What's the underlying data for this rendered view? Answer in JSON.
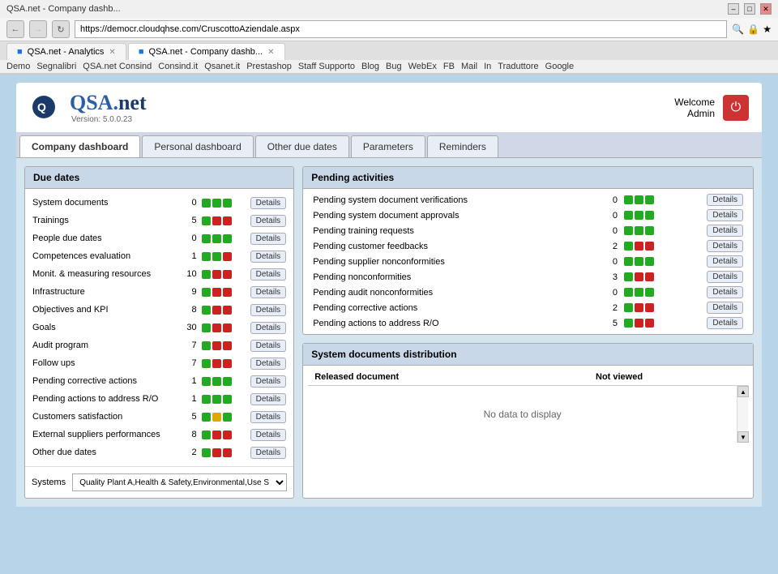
{
  "browser": {
    "title": "QSA.net - Company dashb...",
    "address": "https://democr.cloudqhse.com/CruscottoAziendale.aspx",
    "tabs": [
      {
        "label": "QSA.net - Analytics",
        "active": false,
        "icon": "🟦"
      },
      {
        "label": "QSA.net - Company dashb...",
        "active": true,
        "icon": "🟦"
      }
    ],
    "bookmarks": [
      {
        "label": "Demo"
      },
      {
        "label": "Segnalibri"
      },
      {
        "label": "QSA.net Consind"
      },
      {
        "label": "Consind.it"
      },
      {
        "label": "Qsanet.it"
      },
      {
        "label": "Prestashop"
      },
      {
        "label": "Staff Supporto"
      },
      {
        "label": "Blog"
      },
      {
        "label": "Bug"
      },
      {
        "label": "WebEx"
      },
      {
        "label": "FB"
      },
      {
        "label": "Mail"
      },
      {
        "label": "In"
      },
      {
        "label": "Traduttore"
      },
      {
        "label": "Google"
      }
    ]
  },
  "app": {
    "logo_text": "QSA.net",
    "version": "Version: 5.0.0.23",
    "welcome_label": "Welcome",
    "user_name": "Admin"
  },
  "nav_tabs": {
    "tabs": [
      {
        "label": "Company dashboard",
        "active": true
      },
      {
        "label": "Personal dashboard",
        "active": false
      },
      {
        "label": "Other due dates",
        "active": false
      },
      {
        "label": "Parameters",
        "active": false
      },
      {
        "label": "Reminders",
        "active": false
      }
    ]
  },
  "due_dates": {
    "title": "Due dates",
    "rows": [
      {
        "label": "System documents",
        "count": "0",
        "lights": [
          "green",
          "green",
          "green"
        ],
        "btn": "Details"
      },
      {
        "label": "Trainings",
        "count": "5",
        "lights": [
          "green",
          "red",
          "red"
        ],
        "btn": "Details"
      },
      {
        "label": "People due dates",
        "count": "0",
        "lights": [
          "green",
          "green",
          "green"
        ],
        "btn": "Details"
      },
      {
        "label": "Competences evaluation",
        "count": "1",
        "lights": [
          "green",
          "green",
          "red"
        ],
        "btn": "Details"
      },
      {
        "label": "Monit. & measuring resources",
        "count": "10",
        "lights": [
          "green",
          "red",
          "red"
        ],
        "btn": "Details"
      },
      {
        "label": "Infrastructure",
        "count": "9",
        "lights": [
          "green",
          "red",
          "red"
        ],
        "btn": "Details"
      },
      {
        "label": "Objectives and KPI",
        "count": "8",
        "lights": [
          "green",
          "red",
          "red"
        ],
        "btn": "Details"
      },
      {
        "label": "Goals",
        "count": "30",
        "lights": [
          "green",
          "red",
          "red"
        ],
        "btn": "Details"
      },
      {
        "label": "Audit program",
        "count": "7",
        "lights": [
          "green",
          "red",
          "red"
        ],
        "btn": "Details"
      },
      {
        "label": "Follow ups",
        "count": "7",
        "lights": [
          "green",
          "red",
          "red"
        ],
        "btn": "Details"
      },
      {
        "label": "Pending corrective actions",
        "count": "1",
        "lights": [
          "green",
          "green",
          "green"
        ],
        "btn": "Details"
      },
      {
        "label": "Pending actions to address R/O",
        "count": "1",
        "lights": [
          "green",
          "green",
          "green"
        ],
        "btn": "Details"
      },
      {
        "label": "Customers satisfaction",
        "count": "5",
        "lights": [
          "green",
          "yellow",
          "green"
        ],
        "btn": "Details"
      },
      {
        "label": "External suppliers performances",
        "count": "8",
        "lights": [
          "green",
          "red",
          "red"
        ],
        "btn": "Details"
      },
      {
        "label": "Other due dates",
        "count": "2",
        "lights": [
          "green",
          "red",
          "red"
        ],
        "btn": "Details"
      }
    ],
    "systems_label": "Systems",
    "systems_value": "Quality Plant A,Health & Safety,Environmental,Use S"
  },
  "pending_activities": {
    "title": "Pending activities",
    "rows": [
      {
        "label": "Pending system document verifications",
        "count": "0",
        "lights": [
          "green",
          "green",
          "green"
        ],
        "btn": "Details"
      },
      {
        "label": "Pending system document approvals",
        "count": "0",
        "lights": [
          "green",
          "green",
          "green"
        ],
        "btn": "Details"
      },
      {
        "label": "Pending training requests",
        "count": "0",
        "lights": [
          "green",
          "green",
          "green"
        ],
        "btn": "Details"
      },
      {
        "label": "Pending customer feedbacks",
        "count": "2",
        "lights": [
          "green",
          "red",
          "red"
        ],
        "btn": "Details"
      },
      {
        "label": "Pending supplier nonconformities",
        "count": "0",
        "lights": [
          "green",
          "green",
          "green"
        ],
        "btn": "Details"
      },
      {
        "label": "Pending nonconformities",
        "count": "3",
        "lights": [
          "green",
          "red",
          "red"
        ],
        "btn": "Details"
      },
      {
        "label": "Pending audit nonconformities",
        "count": "0",
        "lights": [
          "green",
          "green",
          "green"
        ],
        "btn": "Details"
      },
      {
        "label": "Pending corrective actions",
        "count": "2",
        "lights": [
          "green",
          "red",
          "red"
        ],
        "btn": "Details"
      },
      {
        "label": "Pending actions to address R/O",
        "count": "5",
        "lights": [
          "green",
          "red",
          "red"
        ],
        "btn": "Details"
      }
    ]
  },
  "system_docs_dist": {
    "title": "System documents distribution",
    "col1": "Released document",
    "col2": "Not viewed",
    "col3": "",
    "no_data": "No data to display"
  }
}
